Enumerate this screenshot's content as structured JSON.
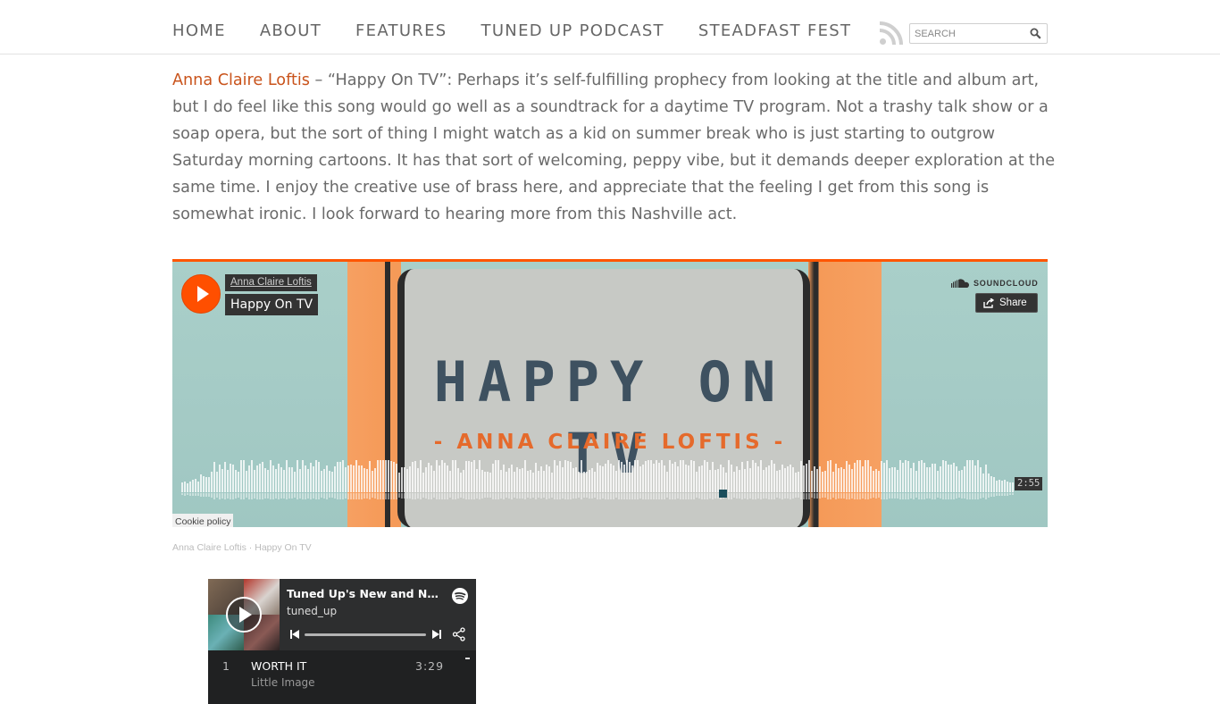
{
  "nav": {
    "links": [
      "HOME",
      "ABOUT",
      "FEATURES",
      "TUNED UP PODCAST",
      "STEADFAST FEST"
    ],
    "rss_icon": "rss-icon",
    "search_placeholder": "SEARCH",
    "search_icon": "magnifier-icon"
  },
  "article": {
    "artist": "Anna Claire Loftis",
    "body": " – “Happy On TV”: Perhaps it’s self-fulfilling prophecy from looking at the title and album art, but I do feel like this song would go well as a soundtrack for a daytime TV program. Not a trashy talk show or a soap opera, but the sort of thing I might watch as a kid on summer break who is just starting to outgrow Saturday morning cartoons. It has that sort of welcoming, peppy vibe, but it demands deeper exploration at the same time. I enjoy the creative use of brass here, and appreciate that the feeling I get from this song is somewhat ironic. I look forward to hearing more from this Nashville act."
  },
  "soundcloud": {
    "artist": "Anna Claire Loftis",
    "track": "Happy On TV",
    "brand": "SOUNDCLOUD",
    "share_label": "Share",
    "duration": "2:55",
    "cookie_policy": "Cookie policy",
    "art_title": "HAPPY ON TV",
    "art_subtitle": "- ANNA CLAIRE LOFTIS -",
    "caption_artist": "Anna Claire Loftis",
    "caption_sep": " · ",
    "caption_track": "Happy On TV",
    "accent_color": "#ff5500"
  },
  "spotify": {
    "playlist_title": "Tuned Up's New and Nifty",
    "user": "tuned_up",
    "tracks": [
      {
        "num": "1",
        "title": "WORTH IT",
        "artist": "Little Image",
        "duration": "3:29"
      }
    ]
  }
}
